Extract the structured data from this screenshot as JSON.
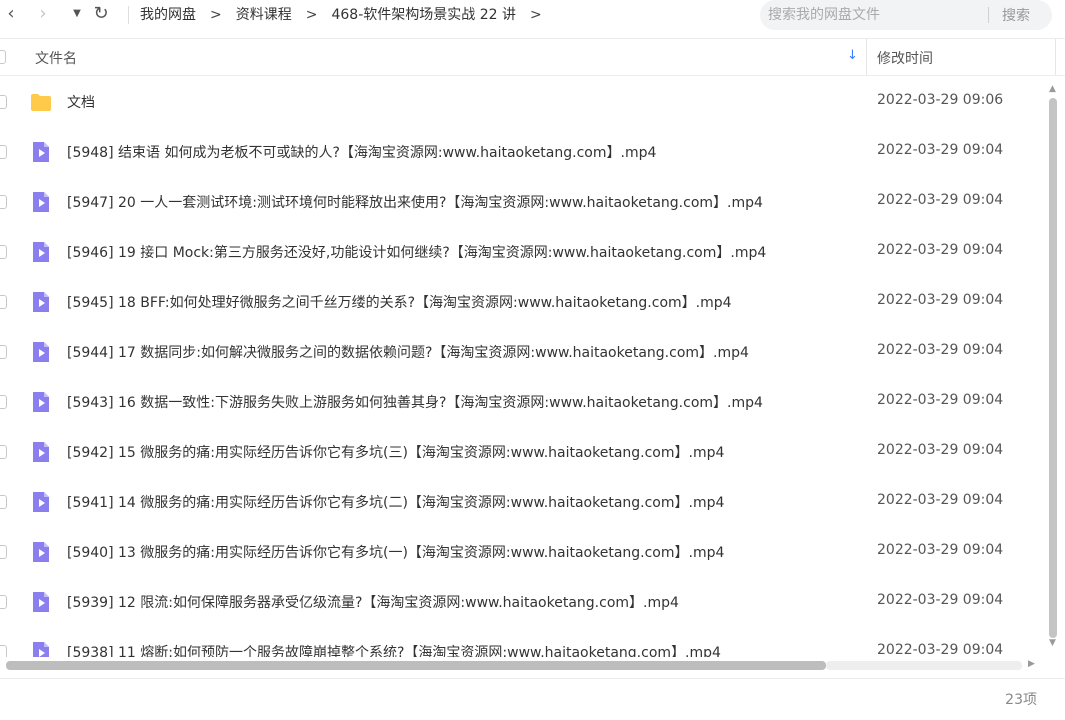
{
  "toolbar": {
    "back_icon": "back-arrow-icon",
    "forward_icon": "forward-arrow-icon",
    "dropdown_icon": "dropdown-caret-icon",
    "refresh_icon": "refresh-icon"
  },
  "breadcrumb": {
    "items": [
      "我的网盘",
      "资料课程",
      "468-软件架构场景实战 22 讲"
    ],
    "separator": ">"
  },
  "search": {
    "placeholder": "搜索我的网盘文件",
    "button_label": "搜索"
  },
  "header": {
    "name_label": "文件名",
    "time_label": "修改时间",
    "sort_icon": "sort-down-arrow-icon"
  },
  "files": [
    {
      "type": "folder",
      "name": "文档",
      "time": "2022-03-29 09:06"
    },
    {
      "type": "video",
      "name": "[5948] 结束语  如何成为老板不可或缺的人?【海淘宝资源网:www.haitaoketang.com】.mp4",
      "time": "2022-03-29 09:04"
    },
    {
      "type": "video",
      "name": "[5947] 20  一人一套测试环境:测试环境何时能释放出来使用?【海淘宝资源网:www.haitaoketang.com】.mp4",
      "time": "2022-03-29 09:04"
    },
    {
      "type": "video",
      "name": "[5946] 19  接口 Mock:第三方服务还没好,功能设计如何继续?【海淘宝资源网:www.haitaoketang.com】.mp4",
      "time": "2022-03-29 09:04"
    },
    {
      "type": "video",
      "name": "[5945] 18  BFF:如何处理好微服务之间千丝万缕的关系?【海淘宝资源网:www.haitaoketang.com】.mp4",
      "time": "2022-03-29 09:04"
    },
    {
      "type": "video",
      "name": "[5944] 17  数据同步:如何解决微服务之间的数据依赖问题?【海淘宝资源网:www.haitaoketang.com】.mp4",
      "time": "2022-03-29 09:04"
    },
    {
      "type": "video",
      "name": "[5943] 16  数据一致性:下游服务失败上游服务如何独善其身?【海淘宝资源网:www.haitaoketang.com】.mp4",
      "time": "2022-03-29 09:04"
    },
    {
      "type": "video",
      "name": "[5942] 15  微服务的痛:用实际经历告诉你它有多坑(三)【海淘宝资源网:www.haitaoketang.com】.mp4",
      "time": "2022-03-29 09:04"
    },
    {
      "type": "video",
      "name": "[5941] 14  微服务的痛:用实际经历告诉你它有多坑(二)【海淘宝资源网:www.haitaoketang.com】.mp4",
      "time": "2022-03-29 09:04"
    },
    {
      "type": "video",
      "name": "[5940] 13  微服务的痛:用实际经历告诉你它有多坑(一)【海淘宝资源网:www.haitaoketang.com】.mp4",
      "time": "2022-03-29 09:04"
    },
    {
      "type": "video",
      "name": "[5939] 12  限流:如何保障服务器承受亿级流量?【海淘宝资源网:www.haitaoketang.com】.mp4",
      "time": "2022-03-29 09:04"
    },
    {
      "type": "video",
      "name": "[5938] 11  熔断:如何预防一个服务故障崩掉整个系统?【海淘宝资源网:www.haitaoketang.com】.mp4",
      "time": "2022-03-29 09:04"
    }
  ],
  "footer": {
    "count_label": "23项"
  },
  "colors": {
    "folder": "#ffc94a",
    "video_icon": "#8b7ff0",
    "accent": "#3b7cff"
  }
}
